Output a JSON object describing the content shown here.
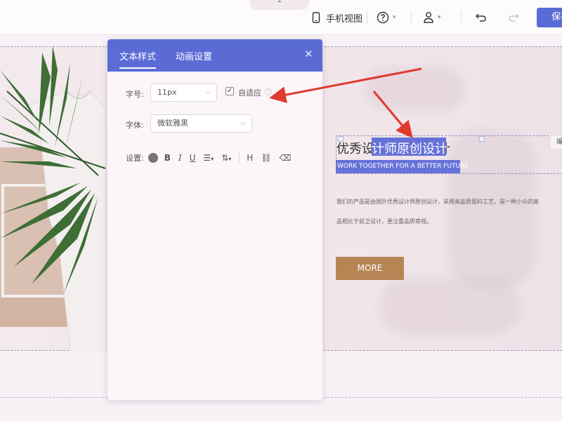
{
  "toolbar": {
    "collapse_glyph": "⌃",
    "phone_view_label": "手机视图",
    "phone_icon": "mobile-phone-icon",
    "help_icon": "question-circle-icon",
    "user_icon": "user-icon",
    "undo_icon": "undo-icon",
    "redo_icon": "redo-icon",
    "save_label": "保存"
  },
  "panel": {
    "tabs": [
      {
        "label": "文本样式",
        "active": true
      },
      {
        "label": "动画设置",
        "active": false
      }
    ],
    "close_glyph": "✕",
    "font_size_label": "字号:",
    "font_size_value": "11px",
    "auto_fit_label": "自适应",
    "auto_fit_checked": true,
    "font_family_label": "字体:",
    "font_family_value": "微软雅黑",
    "settings_label": "设置:",
    "text_color": "#7a7478",
    "format_buttons": [
      "B",
      "I",
      "U"
    ]
  },
  "canvas": {
    "title": "优秀设计师原创设计",
    "subtitle": "WORK TOGETHER FOR A BETTER FUTURE",
    "edit_tag": "编",
    "desc_line1": "我们的产品是由国外优秀设计师原创设计，采用高品质面料工艺，是一种小众的高",
    "desc_line2": "品相比于前卫设计，更注重品质审视。",
    "more_button": "MORE"
  },
  "colors": {
    "accent": "#5b6bd6",
    "highlight": "#6672d9",
    "more_button": "#b78554",
    "arrow": "#e03a2e"
  }
}
